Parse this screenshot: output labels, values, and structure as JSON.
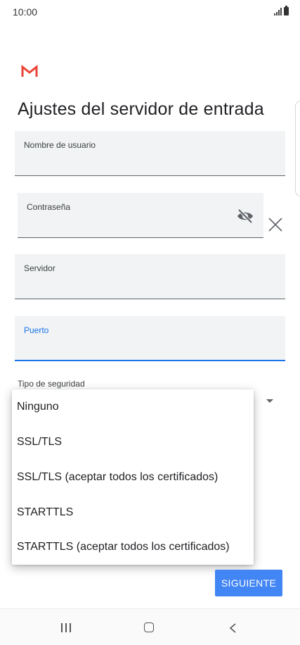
{
  "status_bar": {
    "time": "10:00"
  },
  "app": {
    "logo_icon": "gmail-icon",
    "brand_color": "#ea4335"
  },
  "page": {
    "title": "Ajustes del servidor de entrada"
  },
  "form": {
    "username": {
      "label": "Nombre de usuario",
      "value": ""
    },
    "password": {
      "label": "Contraseña",
      "value": "",
      "visibility_icon": "eye-off-icon",
      "clear_icon": "close-icon"
    },
    "server": {
      "label": "Servidor",
      "value": ""
    },
    "port": {
      "label": "Puerto",
      "value": "",
      "focused": true
    },
    "security": {
      "label": "Tipo de seguridad",
      "options": [
        "Ninguno",
        "SSL/TLS",
        "SSL/TLS (aceptar todos los certificados)",
        "STARTTLS",
        "STARTTLS (aceptar todos los certificados)"
      ]
    }
  },
  "actions": {
    "next_label": "SIGUIENTE",
    "accent_color": "#4285f4"
  },
  "nav_bar": {
    "icons": [
      "recents-icon",
      "home-icon",
      "back-icon"
    ]
  }
}
